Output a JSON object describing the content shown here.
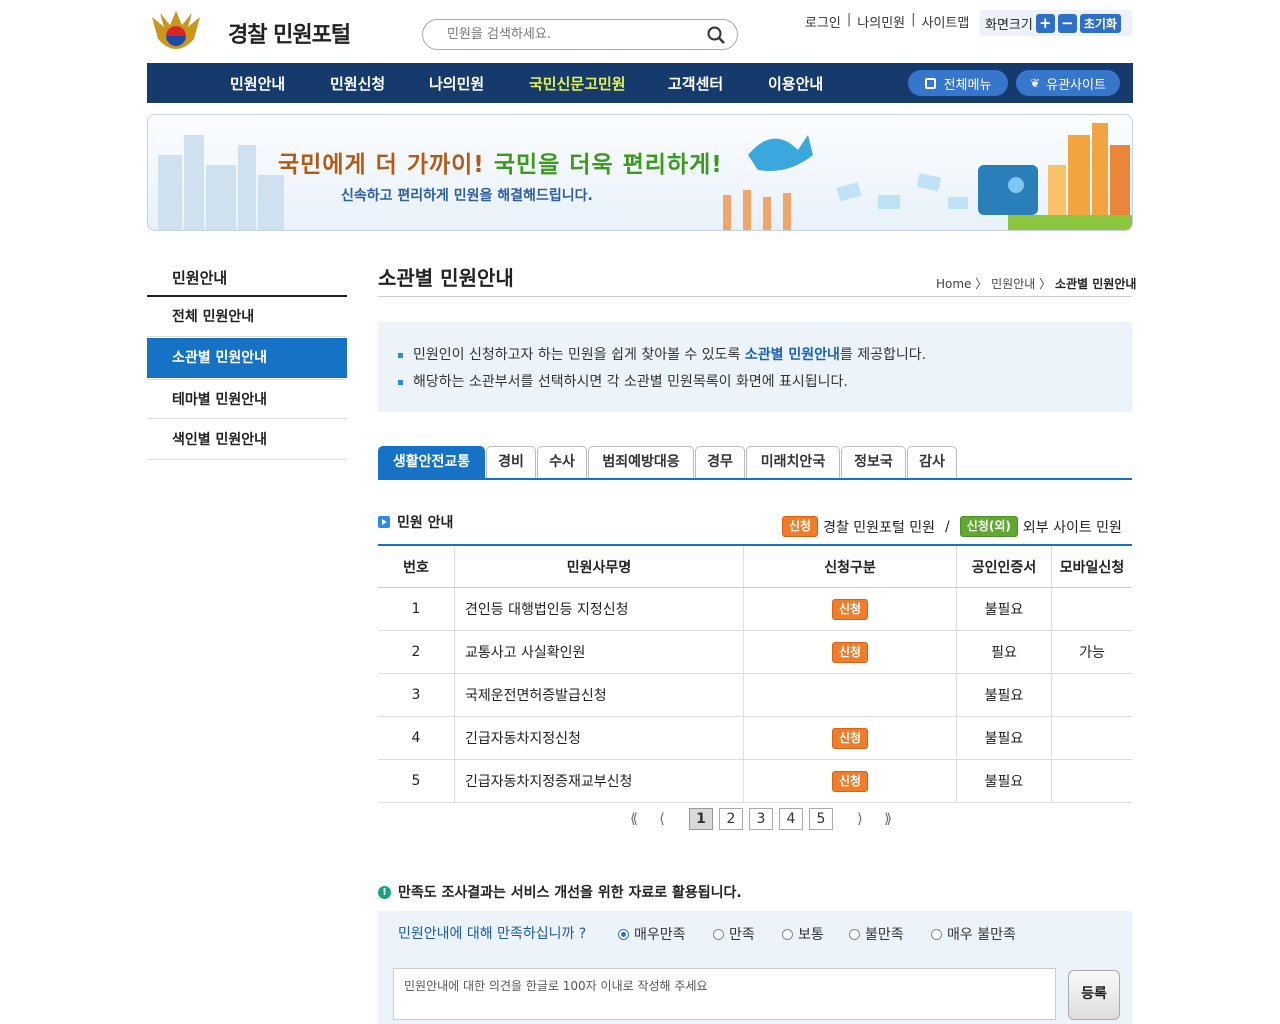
{
  "header": {
    "logo_text": "경찰 민원포털",
    "search_placeholder": "민원을 검색하세요.",
    "util_links": [
      "로그인",
      "나의민원",
      "사이트맵"
    ],
    "font_size_label": "화면크기",
    "font_plus": "+",
    "font_minus": "−",
    "font_reset": "초기화"
  },
  "nav": {
    "items": [
      "민원안내",
      "민원신청",
      "나의민원",
      "국민신문고민원",
      "고객센터",
      "이용안내"
    ],
    "active_index": 3,
    "all_menu": "전체메뉴",
    "related_sites": "유관사이트"
  },
  "banner": {
    "title_part1": "국민에게 더 가까이!",
    "title_part2": "국민을 더욱 편리하게!",
    "subtitle": "신속하고 편리하게 민원을 해결해드립니다."
  },
  "sidebar": {
    "title": "민원안내",
    "items": [
      "전체 민원안내",
      "소관별 민원안내",
      "테마별 민원안내",
      "색인별 민원안내"
    ],
    "active_index": 1
  },
  "content": {
    "title": "소관별 민원안내",
    "breadcrumb": [
      "Home",
      "민원안내",
      "소관별 민원안내"
    ],
    "info": {
      "line1_pre": "민원인이 신청하고자 하는 민원을 쉽게 찾아볼 수 있도록 ",
      "line1_bold": "소관별 민원안내",
      "line1_post": "를 제공합니다.",
      "line2": "해당하는 소관부서를 선택하시면 각 소관별 민원목록이 화면에 표시됩니다."
    },
    "tabs": [
      "생활안전교통",
      "경비",
      "수사",
      "범죄예방대응",
      "경무",
      "미래치안국",
      "정보국",
      "감사"
    ],
    "section_title": "민원 안내",
    "legend": {
      "apply_badge": "신청",
      "apply_text": "경찰 민원포털 민원",
      "separator": "/",
      "external_badge": "신청(외)",
      "external_text": "외부 사이트 민원"
    },
    "table": {
      "headers": [
        "번호",
        "민원사무명",
        "신청구분",
        "공인인증서",
        "모바일신청"
      ],
      "rows": [
        {
          "no": "1",
          "name": "견인등 대행법인등 지정신청",
          "apply": "신청",
          "cert": "불필요",
          "mobile": ""
        },
        {
          "no": "2",
          "name": "교통사고 사실확인원",
          "apply": "신청",
          "cert": "필요",
          "mobile": "가능"
        },
        {
          "no": "3",
          "name": "국제운전면허증발급신청",
          "apply": "",
          "cert": "불필요",
          "mobile": ""
        },
        {
          "no": "4",
          "name": "긴급자동차지정신청",
          "apply": "신청",
          "cert": "불필요",
          "mobile": ""
        },
        {
          "no": "5",
          "name": "긴급자동차지정증재교부신청",
          "apply": "신청",
          "cert": "불필요",
          "mobile": ""
        }
      ]
    },
    "pagination": {
      "first": "⟪",
      "prev": "⟨",
      "pages": [
        "1",
        "2",
        "3",
        "4",
        "5"
      ],
      "current": "1",
      "next": "⟩",
      "last": "⟫"
    }
  },
  "survey": {
    "title": "만족도 조사결과는 서비스 개선을 위한 자료로 활용됩니다.",
    "question": "민원안내에 대해 만족하십니까 ?",
    "options": [
      "매우만족",
      "만족",
      "보통",
      "불만족",
      "매우 불만족"
    ],
    "selected_index": 0,
    "placeholder": "민원안내에 대한 의견을 한글로 100자 이내로 작성해 주세요",
    "submit": "등록"
  },
  "colors": {
    "nav_bg": "#153a6b",
    "nav_active": "#e4f24d",
    "accent_blue": "#1672c4",
    "apply_orange": "#ef7d2b",
    "external_green": "#5fa831",
    "info_bg": "#edf4f9"
  }
}
